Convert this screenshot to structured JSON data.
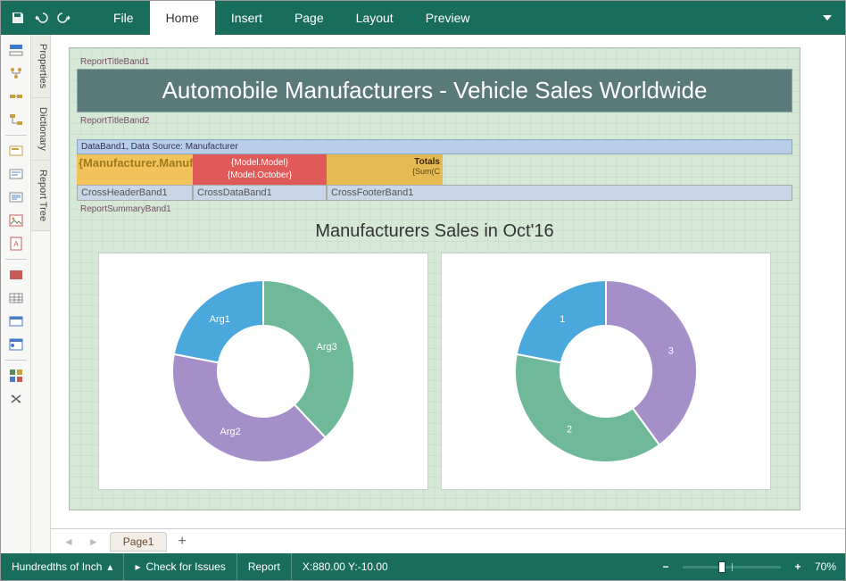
{
  "ribbon": {
    "tabs": [
      "File",
      "Home",
      "Insert",
      "Page",
      "Layout",
      "Preview"
    ],
    "active": "Home"
  },
  "side_panels": [
    "Properties",
    "Dictionary",
    "Report Tree"
  ],
  "report": {
    "bands": {
      "title1": "ReportTitleBand1",
      "title2": "ReportTitleBand2",
      "data": "DataBand1, Data Source: Manufacturer",
      "cross_header": "CrossHeaderBand1",
      "cross_data": "CrossDataBand1",
      "cross_footer": "CrossFooterBand1",
      "summary": "ReportSummaryBand1"
    },
    "title_text": "Automobile Manufacturers - Vehicle Sales Worldwide",
    "header_expr": "{Manufacturer.Manufacturer}",
    "model_lines": {
      "l1": "{Model.Model}",
      "l2": "{Model.October}"
    },
    "totals": {
      "label": "Totals",
      "expr": "{Sum(C"
    },
    "chart_title": "Manufacturers Sales in Oct'16"
  },
  "chart_data": [
    {
      "type": "pie",
      "title": "",
      "hole": 0.5,
      "series": [
        {
          "name": "Arg1",
          "value": 22,
          "color": "#4AA8DC"
        },
        {
          "name": "Arg2",
          "value": 40,
          "color": "#A58FC9"
        },
        {
          "name": "Arg3",
          "value": 38,
          "color": "#6FB99A"
        }
      ]
    },
    {
      "type": "pie",
      "title": "",
      "hole": 0.5,
      "series": [
        {
          "name": "1",
          "value": 22,
          "color": "#4AA8DC"
        },
        {
          "name": "2",
          "value": 38,
          "color": "#6FB99A"
        },
        {
          "name": "3",
          "value": 40,
          "color": "#A58FC9"
        }
      ]
    }
  ],
  "page_tabs": {
    "page1": "Page1"
  },
  "status": {
    "units": "Hundredths of Inch",
    "check": "Check for Issues",
    "report": "Report",
    "coords": "X:880.00 Y:-10.00",
    "zoom": "70%"
  }
}
